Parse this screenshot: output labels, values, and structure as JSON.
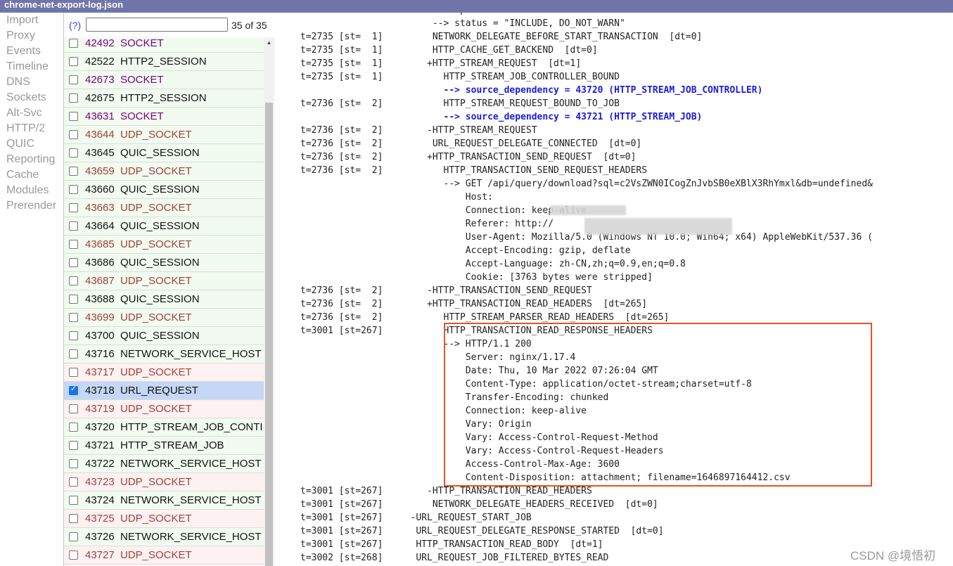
{
  "window": {
    "title": "chrome-net-export-log.json"
  },
  "nav": {
    "items": [
      "Import",
      "Proxy",
      "Events",
      "Timeline",
      "DNS",
      "Sockets",
      "Alt-Svc",
      "HTTP/2",
      "QUIC",
      "Reporting",
      "Cache",
      "Modules",
      "Prerender"
    ]
  },
  "filter": {
    "help_label": "(?)",
    "query": "",
    "count_label": "35 of 35"
  },
  "events": [
    {
      "id": "42492",
      "type": "SOCKET",
      "color": "purple",
      "bg": "green",
      "checked": false
    },
    {
      "id": "42522",
      "type": "HTTP2_SESSION",
      "color": "black",
      "bg": "green",
      "checked": false
    },
    {
      "id": "42673",
      "type": "SOCKET",
      "color": "purple",
      "bg": "green",
      "checked": false
    },
    {
      "id": "42675",
      "type": "HTTP2_SESSION",
      "color": "black",
      "bg": "green",
      "checked": false
    },
    {
      "id": "43631",
      "type": "SOCKET",
      "color": "purple",
      "bg": "green",
      "checked": false
    },
    {
      "id": "43644",
      "type": "UDP_SOCKET",
      "color": "brown",
      "bg": "green",
      "checked": false
    },
    {
      "id": "43645",
      "type": "QUIC_SESSION",
      "color": "black",
      "bg": "green",
      "checked": false
    },
    {
      "id": "43659",
      "type": "UDP_SOCKET",
      "color": "brown",
      "bg": "green",
      "checked": false
    },
    {
      "id": "43660",
      "type": "QUIC_SESSION",
      "color": "black",
      "bg": "green",
      "checked": false
    },
    {
      "id": "43663",
      "type": "UDP_SOCKET",
      "color": "brown",
      "bg": "green",
      "checked": false
    },
    {
      "id": "43664",
      "type": "QUIC_SESSION",
      "color": "black",
      "bg": "green",
      "checked": false
    },
    {
      "id": "43685",
      "type": "UDP_SOCKET",
      "color": "brown",
      "bg": "green",
      "checked": false
    },
    {
      "id": "43686",
      "type": "QUIC_SESSION",
      "color": "black",
      "bg": "green",
      "checked": false
    },
    {
      "id": "43687",
      "type": "UDP_SOCKET",
      "color": "brown",
      "bg": "green",
      "checked": false
    },
    {
      "id": "43688",
      "type": "QUIC_SESSION",
      "color": "black",
      "bg": "green",
      "checked": false
    },
    {
      "id": "43699",
      "type": "UDP_SOCKET",
      "color": "brown",
      "bg": "green",
      "checked": false
    },
    {
      "id": "43700",
      "type": "QUIC_SESSION",
      "color": "black",
      "bg": "green",
      "checked": false
    },
    {
      "id": "43716",
      "type": "NETWORK_SERVICE_HOST",
      "color": "black",
      "bg": "green",
      "checked": false
    },
    {
      "id": "43717",
      "type": "UDP_SOCKET",
      "color": "brown",
      "bg": "pink",
      "checked": false
    },
    {
      "id": "43718",
      "type": "URL_REQUEST",
      "color": "black",
      "bg": "selected",
      "checked": true
    },
    {
      "id": "43719",
      "type": "UDP_SOCKET",
      "color": "brown",
      "bg": "pink",
      "checked": false
    },
    {
      "id": "43720",
      "type": "HTTP_STREAM_JOB_CONTI",
      "color": "black",
      "bg": "green",
      "checked": false
    },
    {
      "id": "43721",
      "type": "HTTP_STREAM_JOB",
      "color": "black",
      "bg": "green",
      "checked": false
    },
    {
      "id": "43722",
      "type": "NETWORK_SERVICE_HOST",
      "color": "black",
      "bg": "green",
      "checked": false
    },
    {
      "id": "43723",
      "type": "UDP_SOCKET",
      "color": "brown",
      "bg": "pink",
      "checked": false
    },
    {
      "id": "43724",
      "type": "NETWORK_SERVICE_HOST",
      "color": "black",
      "bg": "green",
      "checked": false
    },
    {
      "id": "43725",
      "type": "UDP_SOCKET",
      "color": "brown",
      "bg": "pink",
      "checked": false
    },
    {
      "id": "43726",
      "type": "NETWORK_SERVICE_HOST",
      "color": "black",
      "bg": "green",
      "checked": false
    },
    {
      "id": "43727",
      "type": "UDP_SOCKET",
      "color": "brown",
      "bg": "pink",
      "checked": false
    }
  ],
  "log_lines": [
    {
      "text": "                        --> operation = \"send\"",
      "kind": "normal"
    },
    {
      "text": "                        --> status = \"INCLUDE, DO_NOT_WARN\"",
      "kind": "normal"
    },
    {
      "text": "t=2735 [st=  1]         NETWORK_DELEGATE_BEFORE_START_TRANSACTION  [dt=0]",
      "kind": "normal"
    },
    {
      "text": "t=2735 [st=  1]         HTTP_CACHE_GET_BACKEND  [dt=0]",
      "kind": "normal"
    },
    {
      "text": "t=2735 [st=  1]        +HTTP_STREAM_REQUEST  [dt=1]",
      "kind": "normal"
    },
    {
      "text": "t=2735 [st=  1]           HTTP_STREAM_JOB_CONTROLLER_BOUND",
      "kind": "normal"
    },
    {
      "text": "                          --> source_dependency = 43720 (HTTP_STREAM_JOB_CONTROLLER)",
      "kind": "dep"
    },
    {
      "text": "t=2736 [st=  2]           HTTP_STREAM_REQUEST_BOUND_TO_JOB",
      "kind": "normal"
    },
    {
      "text": "                          --> source_dependency = 43721 (HTTP_STREAM_JOB)",
      "kind": "dep"
    },
    {
      "text": "t=2736 [st=  2]        -HTTP_STREAM_REQUEST",
      "kind": "normal"
    },
    {
      "text": "t=2736 [st=  2]         URL_REQUEST_DELEGATE_CONNECTED  [dt=0]",
      "kind": "normal"
    },
    {
      "text": "t=2736 [st=  2]        +HTTP_TRANSACTION_SEND_REQUEST  [dt=0]",
      "kind": "normal"
    },
    {
      "text": "t=2736 [st=  2]           HTTP_TRANSACTION_SEND_REQUEST_HEADERS",
      "kind": "normal"
    },
    {
      "text": "                          --> GET /api/query/download?sql=c2VsZWN0ICogZnJvbSB0eXBlX3RhYmxl&db=undefined&",
      "kind": "normal"
    },
    {
      "text": "                              Host: ",
      "kind": "normal"
    },
    {
      "text": "                              Connection: keep-alive",
      "kind": "normal"
    },
    {
      "text": "                              Referer: http://",
      "kind": "normal"
    },
    {
      "text": "                              User-Agent: Mozilla/5.0 (Windows NT 10.0; Win64; x64) AppleWebKit/537.36 (",
      "kind": "normal"
    },
    {
      "text": "                              Accept-Encoding: gzip, deflate",
      "kind": "normal"
    },
    {
      "text": "                              Accept-Language: zh-CN,zh;q=0.9,en;q=0.8",
      "kind": "normal"
    },
    {
      "text": "                              Cookie: [3763 bytes were stripped]",
      "kind": "normal"
    },
    {
      "text": "t=2736 [st=  2]        -HTTP_TRANSACTION_SEND_REQUEST",
      "kind": "normal"
    },
    {
      "text": "t=2736 [st=  2]        +HTTP_TRANSACTION_READ_HEADERS  [dt=265]",
      "kind": "normal"
    },
    {
      "text": "t=2736 [st=  2]           HTTP_STREAM_PARSER_READ_HEADERS  [dt=265]",
      "kind": "normal"
    },
    {
      "text": "t=3001 [st=267]           HTTP_TRANSACTION_READ_RESPONSE_HEADERS",
      "kind": "normal"
    },
    {
      "text": "                          --> HTTP/1.1 200",
      "kind": "normal"
    },
    {
      "text": "                              Server: nginx/1.17.4",
      "kind": "normal"
    },
    {
      "text": "                              Date: Thu, 10 Mar 2022 07:26:04 GMT",
      "kind": "normal"
    },
    {
      "text": "                              Content-Type: application/octet-stream;charset=utf-8",
      "kind": "normal"
    },
    {
      "text": "                              Transfer-Encoding: chunked",
      "kind": "normal"
    },
    {
      "text": "                              Connection: keep-alive",
      "kind": "normal"
    },
    {
      "text": "                              Vary: Origin",
      "kind": "normal"
    },
    {
      "text": "                              Vary: Access-Control-Request-Method",
      "kind": "normal"
    },
    {
      "text": "                              Vary: Access-Control-Request-Headers",
      "kind": "normal"
    },
    {
      "text": "                              Access-Control-Max-Age: 3600",
      "kind": "normal"
    },
    {
      "text": "                              Content-Disposition: attachment; filename=1646897164412.csv",
      "kind": "normal"
    },
    {
      "text": "t=3001 [st=267]        -HTTP_TRANSACTION_READ_HEADERS",
      "kind": "normal"
    },
    {
      "text": "t=3001 [st=267]         NETWORK_DELEGATE_HEADERS_RECEIVED  [dt=0]",
      "kind": "normal"
    },
    {
      "text": "t=3001 [st=267]     -URL_REQUEST_START_JOB",
      "kind": "normal"
    },
    {
      "text": "t=3001 [st=267]      URL_REQUEST_DELEGATE_RESPONSE_STARTED  [dt=0]",
      "kind": "normal"
    },
    {
      "text": "t=3001 [st=267]      HTTP_TRANSACTION_READ_BODY  [dt=1]",
      "kind": "normal"
    },
    {
      "text": "t=3002 [st=268]      URL_REQUEST_JOB_FILTERED_BYTES_READ",
      "kind": "normal"
    }
  ],
  "watermark": "CSDN @境悟初",
  "colors": {
    "titlebar": "#7075a9",
    "highlight": "#e8512c",
    "dependency": "#1b1be0",
    "selected_row": "#c4d7f5"
  }
}
